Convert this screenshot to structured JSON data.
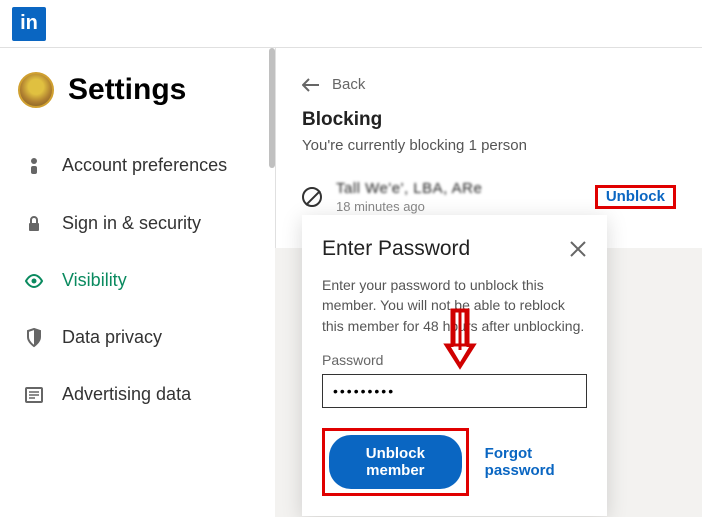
{
  "logo_text": "in",
  "settings_title": "Settings",
  "nav_items": [
    "Account preferences",
    "Sign in & security",
    "Visibility",
    "Data privacy",
    "Advertising data"
  ],
  "back_label": "Back",
  "blocking": {
    "title": "Blocking",
    "subtitle": "You're currently blocking 1 person",
    "member_name": "Tall We'e', LBA, ARe",
    "time": "18 minutes ago",
    "unblock_label": "Unblock"
  },
  "modal": {
    "title": "Enter Password",
    "body": "Enter your password to unblock this member. You will not be able to reblock this member for 48 hours after unblocking.",
    "pw_label": "Password",
    "pw_value": "•••••••••",
    "submit_label": "Unblock member",
    "forgot_label": "Forgot password"
  }
}
